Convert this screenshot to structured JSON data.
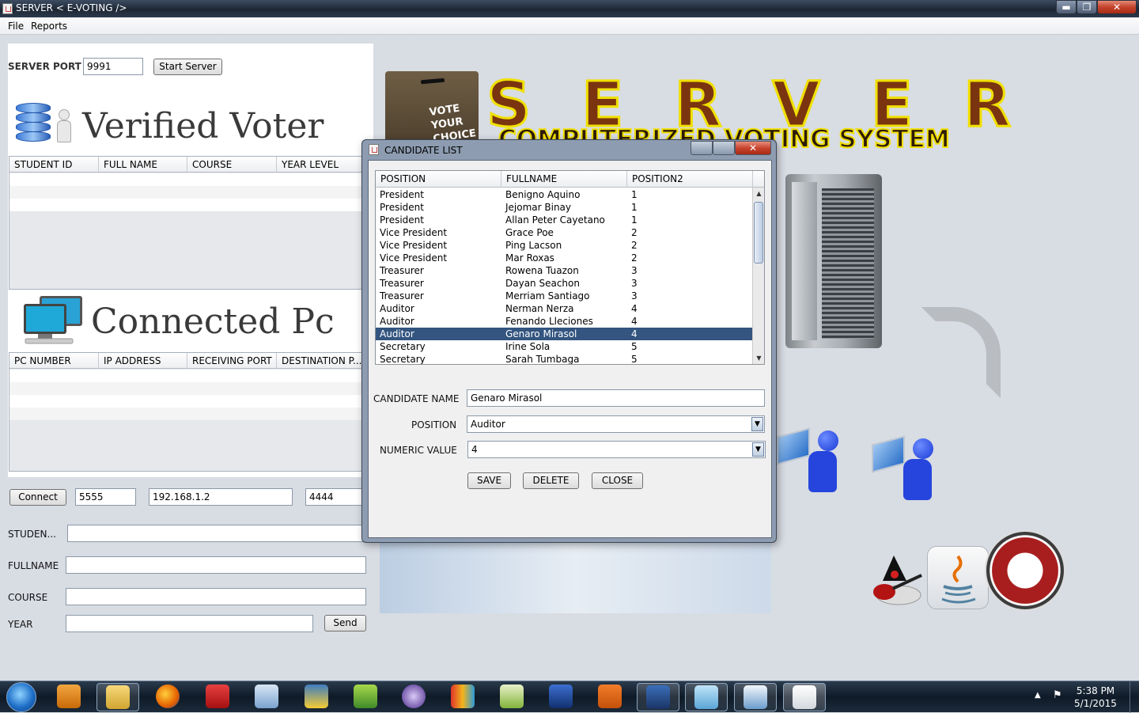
{
  "window": {
    "title": "SERVER   < E-VOTING />",
    "min": "▬",
    "max": "❐",
    "close": "✕"
  },
  "menu": [
    "File",
    "Reports"
  ],
  "server": {
    "port_label": "SERVER PORT",
    "port_value": "9991",
    "start_button": "Start Server"
  },
  "verified": {
    "title": "Verified Voter",
    "columns": [
      "STUDENT ID",
      "FULL NAME",
      "COURSE",
      "YEAR LEVEL"
    ]
  },
  "connected": {
    "title": "Connected Pc",
    "columns": [
      "PC NUMBER",
      "IP ADDRESS",
      "RECEIVING PORT",
      "DESTINATION P..."
    ]
  },
  "connect_bar": {
    "button": "Connect",
    "port1": "5555",
    "ip": "192.168.1.2",
    "port2": "4444"
  },
  "form": {
    "student_label": "STUDEN...",
    "fullname_label": "FULLNAME",
    "course_label": "COURSE",
    "year_label": "YEAR",
    "send_button": "Send"
  },
  "banner": {
    "ballot_text": "VOTE\nYOUR\nCHOICE",
    "server_word": "SERVER",
    "subtitle": "COMPUTERIZED VOTING SYSTEM"
  },
  "dialog": {
    "title": "CANDIDATE LIST",
    "columns": [
      "POSITION",
      "FULLNAME",
      "POSITION2"
    ],
    "rows": [
      [
        "President",
        "Benigno Aquino",
        "1"
      ],
      [
        "President",
        "Jejomar Binay",
        "1"
      ],
      [
        "President",
        "Allan Peter Cayetano",
        "1"
      ],
      [
        "Vice President",
        "Grace Poe",
        "2"
      ],
      [
        "Vice President",
        "Ping Lacson",
        "2"
      ],
      [
        "Vice President",
        "Mar Roxas",
        "2"
      ],
      [
        "Treasurer",
        "Rowena Tuazon",
        "3"
      ],
      [
        "Treasurer",
        "Dayan Seachon",
        "3"
      ],
      [
        "Treasurer",
        "Merriam Santiago",
        "3"
      ],
      [
        "Auditor",
        "Nerman Nerza",
        "4"
      ],
      [
        "Auditor",
        "Fenando Lleciones",
        "4"
      ],
      [
        "Auditor",
        "Genaro Mirasol",
        "4"
      ],
      [
        "Secretary",
        "Irine Sola",
        "5"
      ],
      [
        "Secretary",
        "Sarah Tumbaga",
        "5"
      ]
    ],
    "selected_index": 11,
    "candidate_label": "CANDIDATE NAME",
    "candidate_value": "Genaro Mirasol",
    "position_label": "POSITION",
    "position_value": "Auditor",
    "numeric_label": "NUMERIC VALUE",
    "numeric_value": "4",
    "save": "SAVE",
    "delete": "DELETE",
    "close": "CLOSE"
  },
  "taskbar": {
    "time": "5:38 PM",
    "date": "5/1/2015"
  }
}
